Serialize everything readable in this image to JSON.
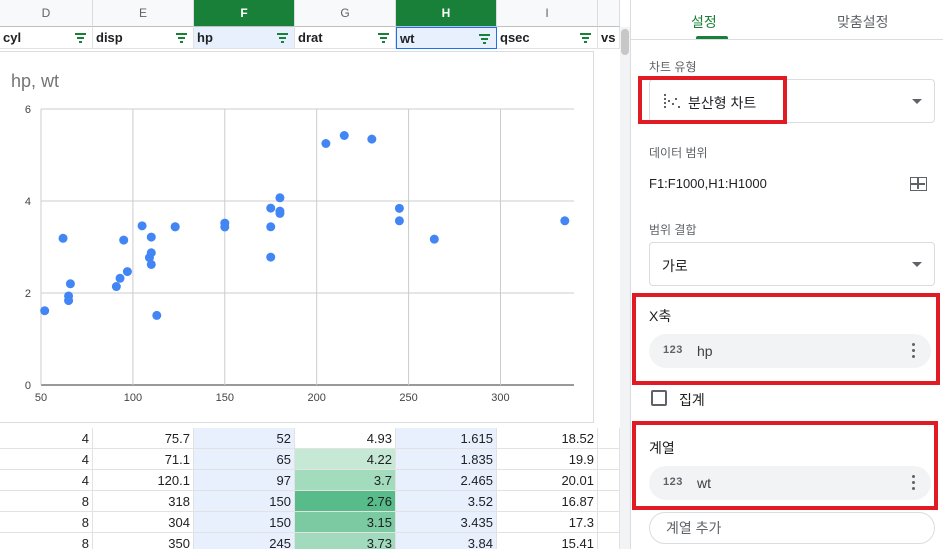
{
  "sheet": {
    "columns": [
      {
        "letter": "D",
        "header": "cyl",
        "selected": false
      },
      {
        "letter": "E",
        "header": "disp",
        "selected": false
      },
      {
        "letter": "F",
        "header": "hp",
        "selected": true
      },
      {
        "letter": "G",
        "header": "drat",
        "selected": false
      },
      {
        "letter": "H",
        "header": "wt",
        "selected": true
      },
      {
        "letter": "I",
        "header": "qsec",
        "selected": false
      },
      {
        "letter": "",
        "header": "vs",
        "selected": false
      }
    ],
    "rows": [
      [
        "4",
        "75.7",
        "52",
        "4.93",
        "1.615",
        "18.52"
      ],
      [
        "4",
        "71.1",
        "65",
        "4.22",
        "1.835",
        "19.9"
      ],
      [
        "4",
        "120.1",
        "97",
        "3.7",
        "2.465",
        "20.01"
      ],
      [
        "8",
        "318",
        "150",
        "2.76",
        "3.52",
        "16.87"
      ],
      [
        "8",
        "304",
        "150",
        "3.15",
        "3.435",
        "17.3"
      ],
      [
        "8",
        "350",
        "245",
        "3.73",
        "3.84",
        "15.41"
      ]
    ],
    "drat_colors": [
      "#ffffff",
      "#c6e9d6",
      "#a3dbbd",
      "#57bb8a",
      "#7ccaa2",
      "#a2dabd"
    ]
  },
  "chart_data": {
    "type": "scatter",
    "title": "hp, wt",
    "xlabel": "",
    "ylabel": "",
    "xlim": [
      50,
      340
    ],
    "ylim": [
      0,
      6
    ],
    "xticks": [
      "50",
      "100",
      "150",
      "200",
      "250",
      "300"
    ],
    "yticks": [
      "0",
      "2",
      "4",
      "6"
    ],
    "grid": true,
    "color": "#4285f4",
    "series": [
      {
        "name": "wt",
        "points": [
          [
            52,
            1.615
          ],
          [
            62,
            3.19
          ],
          [
            65,
            1.835
          ],
          [
            65,
            1.935
          ],
          [
            66,
            2.2
          ],
          [
            91,
            2.14
          ],
          [
            93,
            2.32
          ],
          [
            95,
            3.15
          ],
          [
            97,
            2.465
          ],
          [
            105,
            3.46
          ],
          [
            109,
            2.77
          ],
          [
            110,
            2.875
          ],
          [
            110,
            3.215
          ],
          [
            110,
            2.62
          ],
          [
            113,
            1.513
          ],
          [
            123,
            3.44
          ],
          [
            123,
            3.44
          ],
          [
            150,
            3.52
          ],
          [
            150,
            3.435
          ],
          [
            175,
            3.845
          ],
          [
            175,
            3.44
          ],
          [
            175,
            2.78
          ],
          [
            180,
            4.07
          ],
          [
            180,
            3.73
          ],
          [
            180,
            3.78
          ],
          [
            205,
            5.25
          ],
          [
            215,
            5.424
          ],
          [
            230,
            5.345
          ],
          [
            245,
            3.84
          ],
          [
            245,
            3.57
          ],
          [
            264,
            3.17
          ],
          [
            335,
            3.57
          ]
        ]
      }
    ]
  },
  "panel": {
    "tabs": [
      "설정",
      "맞춤설정"
    ],
    "chart_type_label": "차트 유형",
    "chart_type_value": "분산형 차트",
    "data_range_label": "데이터 범위",
    "data_range_value": "F1:F1000,H1:H1000",
    "combine_label": "범위 결합",
    "combine_value": "가로",
    "x_axis_label": "X축",
    "x_axis_chip": {
      "type": "123",
      "value": "hp"
    },
    "aggregate_label": "집계",
    "series_label": "계열",
    "series_chip": {
      "type": "123",
      "value": "wt"
    },
    "add_series_label": "계열 추가"
  },
  "colors": {
    "accent": "#188038",
    "highlight": "#e01b24",
    "selection": "#e8f0fe",
    "point": "#4285f4"
  }
}
